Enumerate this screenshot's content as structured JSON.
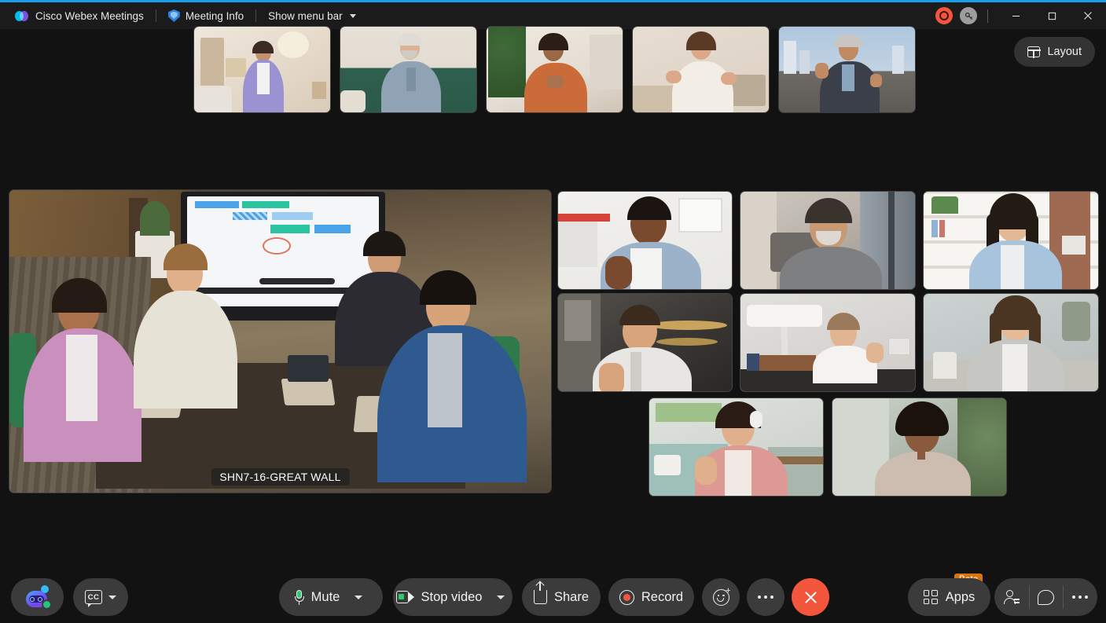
{
  "app": {
    "title": "Cisco Webex Meetings",
    "accent_color": "#1b9ded",
    "background_color": "#121212"
  },
  "titlebar": {
    "logo_icon": "webex-logo-icon",
    "app_name": "Cisco Webex Meetings",
    "meeting_info_label": "Meeting Info",
    "meeting_info_icon": "shield-icon",
    "menu_bar_label": "Show menu bar",
    "menu_bar_caret_icon": "chevron-down-icon",
    "recording_indicator_icon": "recording-indicator-icon",
    "recording_indicator_color": "#f4553d",
    "encryption_icon": "key-icon",
    "minimize_icon": "minimize-icon",
    "maximize_icon": "maximize-icon",
    "close_icon": "close-icon"
  },
  "layout_button": {
    "label": "Layout",
    "icon": "layout-grid-icon"
  },
  "stage": {
    "main_video_label": "SHN7-16-GREAT WALL",
    "filmstrip": [
      {
        "name": "participant-thumb-1",
        "description": "woman in purple shirt in living room"
      },
      {
        "name": "participant-thumb-2",
        "description": "older man with white beard on green sofa"
      },
      {
        "name": "participant-thumb-3",
        "description": "woman in orange top with plant"
      },
      {
        "name": "participant-thumb-4",
        "description": "woman in white blouse gesturing"
      },
      {
        "name": "participant-thumb-5",
        "description": "man waving with city skyline"
      }
    ],
    "grid": [
      {
        "name": "participant-tile-1",
        "description": "man giving thumbs up in denim shirt"
      },
      {
        "name": "participant-tile-2",
        "description": "man with grey beard in grey sweater"
      },
      {
        "name": "participant-tile-3",
        "description": "woman in light blue shirt by bookshelf"
      },
      {
        "name": "participant-tile-4",
        "description": "man in white shirt in dark office"
      },
      {
        "name": "participant-tile-5",
        "description": "woman waving at desk with lamp"
      },
      {
        "name": "participant-tile-6",
        "description": "woman in grey cardigan"
      },
      {
        "name": "participant-tile-7",
        "description": "woman with headset in kitchen"
      },
      {
        "name": "participant-tile-8",
        "description": "woman with glasses smiling"
      }
    ]
  },
  "toolbar": {
    "ai_assistant": {
      "name": "ai-assistant-button",
      "icon": "ai-assistant-icon",
      "status_color": "#26c281"
    },
    "captions": {
      "name": "closed-captions-button",
      "icon": "closed-captions-icon",
      "caret_icon": "chevron-down-icon",
      "label": "CC"
    },
    "mute": {
      "label": "Mute",
      "icon": "microphone-icon",
      "caret_icon": "chevron-down-icon",
      "icon_color": "#2ecc71"
    },
    "video": {
      "label": "Stop video",
      "icon": "camera-icon",
      "caret_icon": "chevron-down-icon",
      "icon_color": "#2ecc71"
    },
    "share": {
      "label": "Share",
      "icon": "share-upload-icon"
    },
    "record": {
      "label": "Record",
      "icon": "record-circle-icon",
      "icon_color": "#f4553d"
    },
    "reactions": {
      "name": "reactions-button",
      "icon": "smiley-plus-icon"
    },
    "more_options": {
      "name": "more-options-button",
      "icon": "ellipsis-icon"
    },
    "leave": {
      "name": "leave-meeting-button",
      "icon": "close-x-icon",
      "color": "#f4553d"
    },
    "apps": {
      "label": "Apps",
      "icon": "apps-grid-icon",
      "badge": "Beta",
      "badge_color": "#d87511"
    },
    "participants": {
      "name": "participants-button",
      "icon": "participants-icon"
    },
    "chat": {
      "name": "chat-button",
      "icon": "chat-bubble-icon"
    },
    "panel_more": {
      "name": "panel-more-button",
      "icon": "ellipsis-icon"
    }
  }
}
